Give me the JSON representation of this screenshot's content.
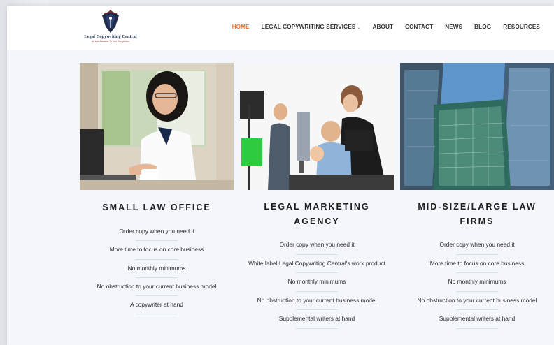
{
  "header": {
    "logo": {
      "name": "Legal Copywriting Central",
      "tagline": "An Law Advocate To Your Competition"
    },
    "nav": [
      {
        "label": "HOME",
        "active": true
      },
      {
        "label": "LEGAL COPYWRITING SERVICES",
        "has_dropdown": true
      },
      {
        "label": "ABOUT"
      },
      {
        "label": "CONTACT"
      },
      {
        "label": "NEWS"
      },
      {
        "label": "BLOG"
      },
      {
        "label": "RESOURCES"
      }
    ],
    "accent_color": "#e8772e"
  },
  "columns": [
    {
      "title": "SMALL LAW OFFICE",
      "photo": "woman-at-laptop",
      "features": [
        "Order copy when you need it",
        "More time to focus on core business",
        "No monthly minimums",
        "No obstruction to your current business model",
        "A copywriter at hand"
      ]
    },
    {
      "title": "LEGAL MARKETING AGENCY",
      "photo": "creative-team-at-screen",
      "features": [
        "Order copy when you need it",
        "White label Legal Copywriting Central's work product",
        "No monthly minimums",
        "No obstruction to your current business model",
        "Supplemental writers at hand"
      ]
    },
    {
      "title": "MID-SIZE/LARGE LAW FIRMS",
      "photo": "glass-office-towers",
      "features": [
        "Order copy when you need it",
        "More time to focus on core business",
        "No monthly minimums",
        "No obstruction to your current business model",
        "Supplemental writers at hand"
      ]
    }
  ]
}
